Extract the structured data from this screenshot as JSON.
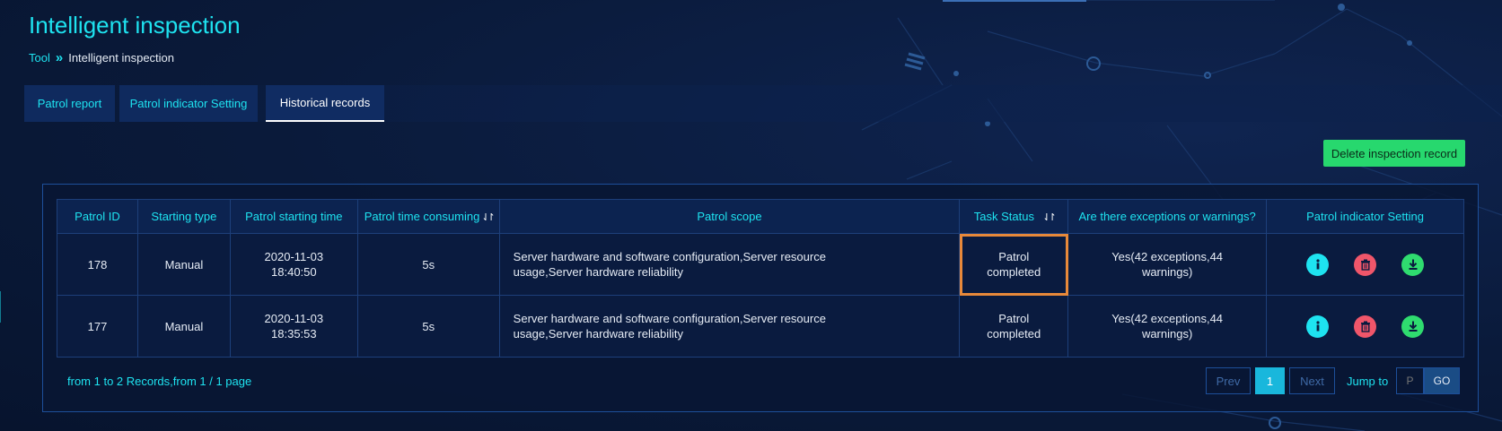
{
  "header": {
    "title": "Intelligent inspection",
    "breadcrumb": {
      "root": "Tool",
      "separator": "»",
      "current": "Intelligent inspection"
    }
  },
  "tabs": [
    {
      "label": "Patrol report",
      "active": false
    },
    {
      "label": "Patrol indicator Setting",
      "active": false
    },
    {
      "label": "Historical records",
      "active": true
    }
  ],
  "toolbar": {
    "delete_label": "Delete inspection record"
  },
  "table": {
    "columns": [
      "Patrol ID",
      "Starting type",
      "Patrol starting time",
      "Patrol time consuming",
      "Patrol scope",
      "Task Status",
      "Are there exceptions or warnings?",
      "Patrol indicator Setting"
    ],
    "rows": [
      {
        "id": "178",
        "type": "Manual",
        "start_date": "2020-11-03",
        "start_time": "18:40:50",
        "duration": "5s",
        "scope_line1": "Server hardware and software configuration,Server resource",
        "scope_line2": "usage,Server hardware reliability",
        "status_line1": "Patrol",
        "status_line2": "completed",
        "exceptions_line1": "Yes(42 exceptions,44",
        "exceptions_line2": "warnings)"
      },
      {
        "id": "177",
        "type": "Manual",
        "start_date": "2020-11-03",
        "start_time": "18:35:53",
        "duration": "5s",
        "scope_line1": "Server hardware and software configuration,Server resource",
        "scope_line2": "usage,Server hardware reliability",
        "status_line1": "Patrol",
        "status_line2": "completed",
        "exceptions_line1": "Yes(42 exceptions,44",
        "exceptions_line2": "warnings)"
      }
    ],
    "row_actions": [
      "info-icon",
      "trash-icon",
      "download-icon"
    ]
  },
  "pagination": {
    "summary": "from 1 to 2 Records,from 1 / 1 page",
    "prev": "Prev",
    "current_page": "1",
    "next": "Next",
    "jump_label": "Jump to",
    "jump_placeholder": "P",
    "go": "GO"
  },
  "colors": {
    "accent": "#1ee3f0",
    "background": "#0a1a3a",
    "delete_button": "#27d86e",
    "highlight": "#e8893a",
    "info": "#1ee3f0",
    "danger": "#f0566a",
    "success": "#2fdc6f"
  }
}
